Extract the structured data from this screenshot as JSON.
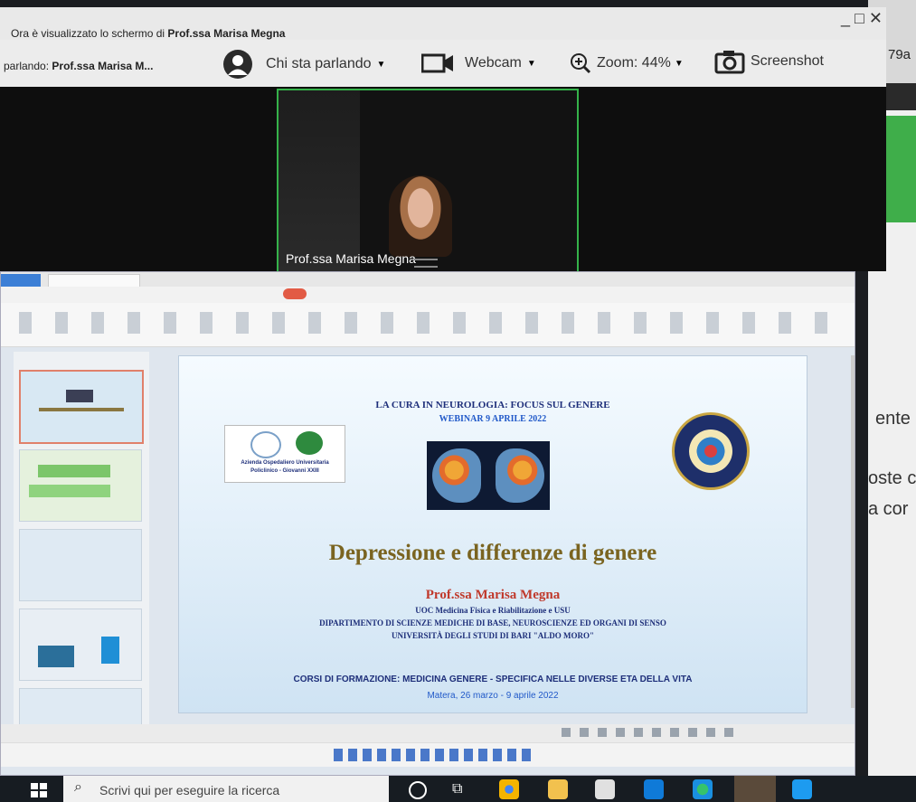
{
  "zoom": {
    "viewing_text": "Ora è visualizzato lo schermo di ",
    "viewing_name": "Prof.ssa Marisa Megna",
    "speaking_label": "parlando:",
    "speaking_name": "Prof.ssa Marisa M...",
    "speaker_view": "Chi sta parlando",
    "webcam": "Webcam",
    "zoom_level": "Zoom: 44%",
    "screenshot": "Screenshot",
    "video_name": "Prof.ssa Marisa Megna"
  },
  "background_app": {
    "snippet_top": "79a",
    "snippets": [
      "ente",
      "oste c",
      "a cor"
    ]
  },
  "slide": {
    "header_title": "LA CURA IN NEUROLOGIA: FOCUS SUL GENERE",
    "header_date": "WEBINAR 9 APRILE 2022",
    "logo_left_line1": "Azienda Ospedaliero Universitaria",
    "logo_left_line2": "Policlinico - Giovanni XXIII",
    "main_title": "Depressione e differenze di genere",
    "author": "Prof.ssa Marisa Megna",
    "affiliation_1": "UOC Medicina Fisica e Riabilitazione e USU",
    "affiliation_2": "DIPARTIMENTO DI SCIENZE MEDICHE DI BASE, NEUROSCIENZE ED ORGANI DI SENSO",
    "affiliation_3": "UNIVERSITÀ DEGLI STUDI DI BARI \"ALDO MORO\"",
    "course": "CORSI DI FORMAZIONE: MEDICINA GENERE - SPECIFICA NELLE DIVERSE ETA DELLA VITA",
    "place_date": "Matera, 26 marzo - 9 aprile 2022"
  },
  "taskbar": {
    "search_placeholder": "Scrivi qui per eseguire la ricerca"
  },
  "colors": {
    "title_gold": "#7a6420",
    "author_red": "#c0392b",
    "header_blue": "#1e2f7a",
    "video_border": "#35b24a"
  }
}
